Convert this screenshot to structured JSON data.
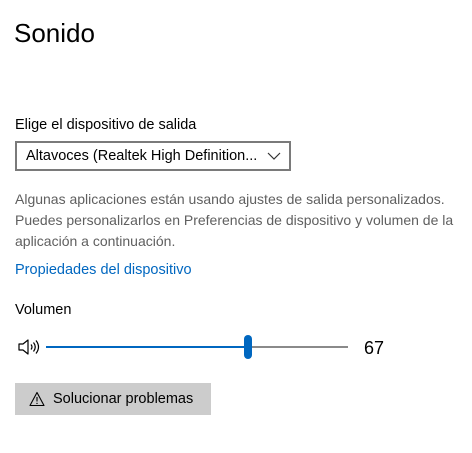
{
  "page": {
    "title": "Sonido"
  },
  "output": {
    "label": "Elige el dispositivo de salida",
    "selected_device": "Altavoces (Realtek High Definition...",
    "description": "Algunas aplicaciones están usando ajustes de salida personalizados. Puedes personalizarlos en Preferencias de dispositivo y volumen de la aplicación a continuación.",
    "properties_link": "Propiedades del dispositivo"
  },
  "volume": {
    "label": "Volumen",
    "value": 67,
    "value_text": "67",
    "max": 100
  },
  "troubleshoot": {
    "label": "Solucionar problemas"
  },
  "icons": {
    "speaker": "speaker-icon",
    "warning": "warning-icon",
    "dropdown": "chevron-down-icon"
  },
  "colors": {
    "accent": "#0067c0",
    "description_text": "#5f5f5f",
    "button_bg": "#cccccc"
  }
}
